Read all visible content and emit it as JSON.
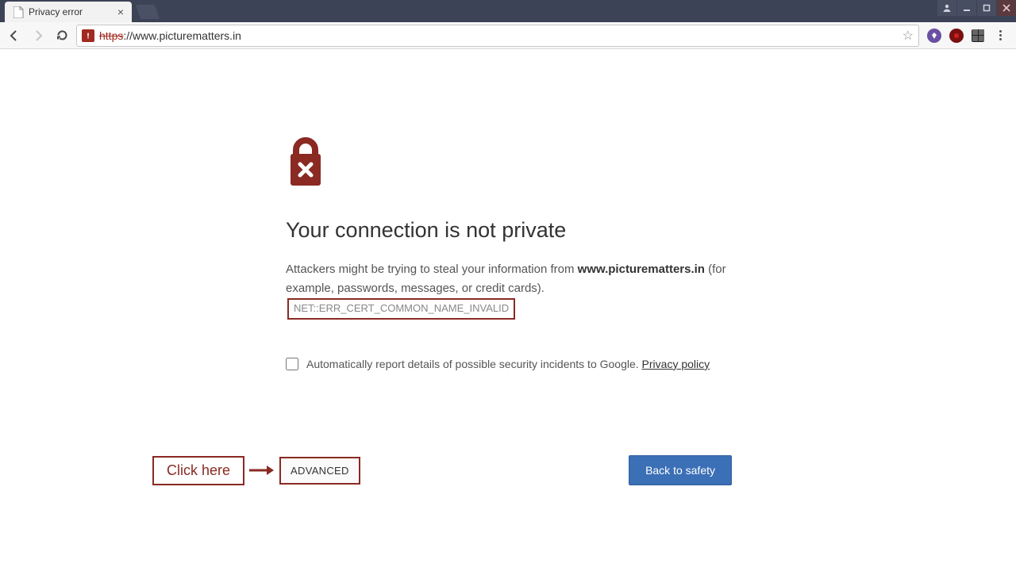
{
  "tab": {
    "title": "Privacy error"
  },
  "address": {
    "scheme": "https",
    "rest": "://www.picturematters.in"
  },
  "page": {
    "heading": "Your connection is not private",
    "para_prefix": "Attackers might be trying to steal your information from ",
    "domain": "www.picturematters.in",
    "para_suffix": " (for example, passwords, messages, or credit cards).",
    "error_code": "NET::ERR_CERT_COMMON_NAME_INVALID",
    "report_label": "Automatically report details of possible security incidents to Google. ",
    "privacy_link": "Privacy policy"
  },
  "buttons": {
    "callout": "Click here",
    "advanced": "ADVANCED",
    "back": "Back to safety"
  }
}
